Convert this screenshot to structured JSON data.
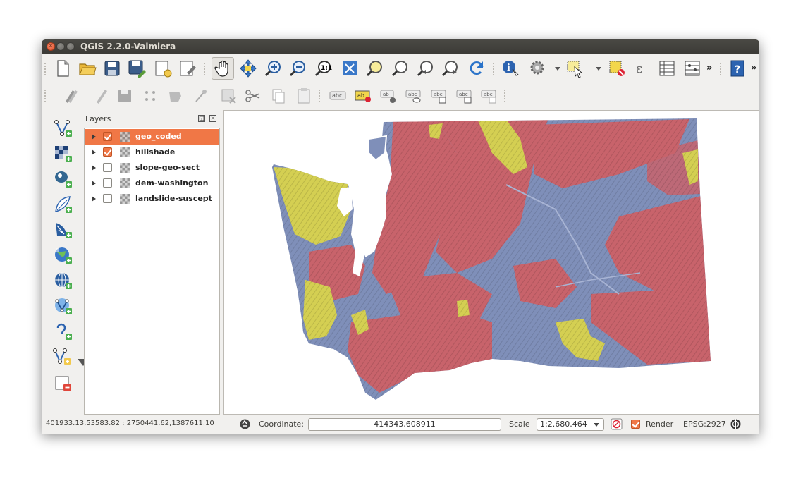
{
  "window": {
    "title": "QGIS 2.2.0-Valmiera"
  },
  "toolbar_main": {
    "tools": [
      "new-project-icon",
      "open-project-icon",
      "save-project-icon",
      "save-as-icon",
      "new-print-composer-icon",
      "composer-manager-icon",
      "pan-icon",
      "pan-to-selection-icon",
      "zoom-in-icon",
      "zoom-out-icon",
      "zoom-actual-icon",
      "zoom-full-icon",
      "zoom-to-selection-icon",
      "zoom-to-layer-icon",
      "zoom-last-icon",
      "zoom-next-icon",
      "refresh-icon",
      "identify-icon",
      "run-action-icon",
      "select-features-icon",
      "deselect-icon",
      "field-calculator-icon",
      "attribute-table-icon",
      "statistics-icon",
      "help-icon"
    ],
    "overflow": "»"
  },
  "toolbar_digitize": {
    "tools": [
      "current-edits-icon",
      "toggle-editing-icon",
      "save-edits-icon",
      "add-feature-icon",
      "move-feature-icon",
      "node-tool-icon",
      "delete-selected-icon",
      "cut-features-icon",
      "copy-features-icon",
      "paste-features-icon",
      "label-tool-icon",
      "layer-labeling-icon",
      "move-label-icon",
      "rotate-label-icon",
      "show-hide-labels-icon",
      "pin-labels-icon",
      "change-label-icon"
    ],
    "label_text": "abc",
    "label_text_highlight": "ab"
  },
  "left_toolbar": {
    "tools": [
      "add-vector-layer-icon",
      "add-raster-layer-icon",
      "add-postgis-layer-icon",
      "add-spatialite-layer-icon",
      "add-mssql-layer-icon",
      "add-wms-layer-icon",
      "add-wcs-layer-icon",
      "add-wfs-layer-icon",
      "add-delimited-text-icon",
      "new-shapefile-layer-icon",
      "remove-layer-icon"
    ]
  },
  "layers_panel": {
    "title": "Layers",
    "items": [
      {
        "name": "geo_coded",
        "checked": true,
        "selected": true
      },
      {
        "name": "hillshade",
        "checked": true,
        "selected": false
      },
      {
        "name": "slope-geo-sect",
        "checked": false,
        "selected": false
      },
      {
        "name": "dem-washington",
        "checked": false,
        "selected": false
      },
      {
        "name": "landslide-suscept",
        "checked": false,
        "selected": false
      }
    ]
  },
  "map": {
    "colors": {
      "red": "#c8636b",
      "blue": "#7f8fb9",
      "yellow": "#d4cf52"
    }
  },
  "status": {
    "extent": "401933.13,53583.82 : 2750441.62,1387611.10",
    "coordinate_label": "Coordinate:",
    "coordinate": "414343,608911",
    "scale_label": "Scale",
    "scale": "1:2.680.464",
    "render_label": "Render",
    "render_checked": true,
    "crs": "EPSG:2927"
  },
  "colors": {
    "accent": "#f07746",
    "titlebar": "#3c3b37"
  }
}
